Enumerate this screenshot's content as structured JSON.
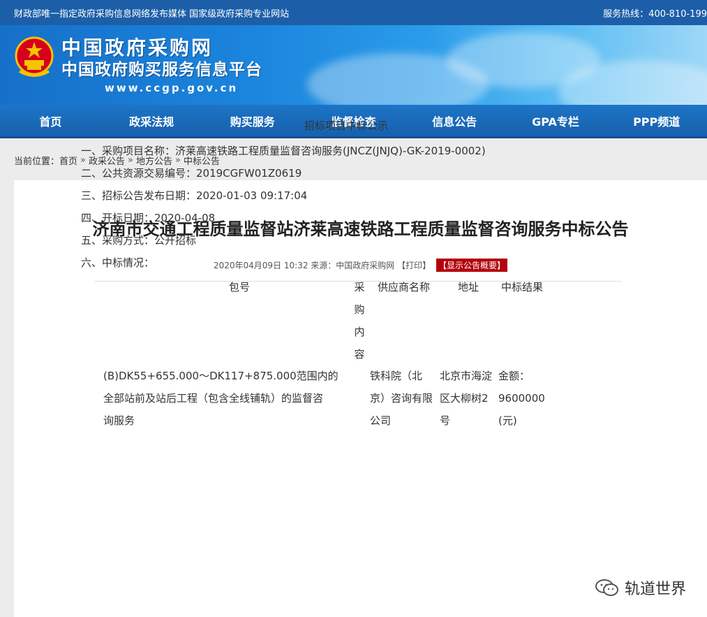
{
  "topbar": {
    "left": "财政部唯一指定政府采购信息网络发布媒体 国家级政府采购专业网站",
    "right": "服务热线：400-810-199"
  },
  "brand": {
    "title1": "中国政府采购网",
    "title2": "中国政府购买服务信息平台",
    "url": "www.ccgp.gov.cn"
  },
  "nav": [
    "首页",
    "政采法规",
    "购买服务",
    "监督检查",
    "信息公告",
    "GPA专栏",
    "PPP频道"
  ],
  "breadcrumb": {
    "label": "当前位置：",
    "items": [
      "首页",
      "政采公告",
      "地方公告",
      "中标公告"
    ],
    "separator": "»"
  },
  "article": {
    "title": "济南市交通工程质量监督站济莱高速铁路工程质量监督咨询服务中标公告",
    "meta_date": "2020年04月09日 10:32",
    "meta_source": "来源：中国政府采购网",
    "meta_print": "【打印】",
    "meta_badge": "【显示公告概要】",
    "subhead": "招标项目中标公示",
    "lines": [
      "一、采购项目名称：济莱高速铁路工程质量监督咨询服务(JNCZ(JNJQ)-GK-2019-0002)",
      "二、公共资源交易编号：2019CGFW01Z0619",
      "三、招标公告发布日期：2020-01-03 09:17:04",
      "四、开标日期：2020-04-08",
      "五、采购方式：公开招标",
      "六、中标情况："
    ],
    "table": {
      "headers": {
        "package": "包号",
        "content": [
          "采",
          "购",
          "内",
          "容"
        ],
        "supplier": "供应商名称",
        "address": "地址",
        "result": "中标结果"
      },
      "row": {
        "package_lines": [
          "(B)DK55+655.000～DK117+875.000范围内的",
          "全部站前及站后工程（包含全线铺轨）的监督咨",
          "询服务"
        ],
        "supplier_lines": [
          "铁科院（北",
          "京）咨询有限",
          "公司"
        ],
        "address_lines": [
          "北京市海淀",
          "区大柳树2",
          "号"
        ],
        "result_lines": [
          "金额：",
          "9600000",
          "(元)"
        ]
      }
    }
  },
  "watermark": {
    "text": "轨道世界"
  }
}
